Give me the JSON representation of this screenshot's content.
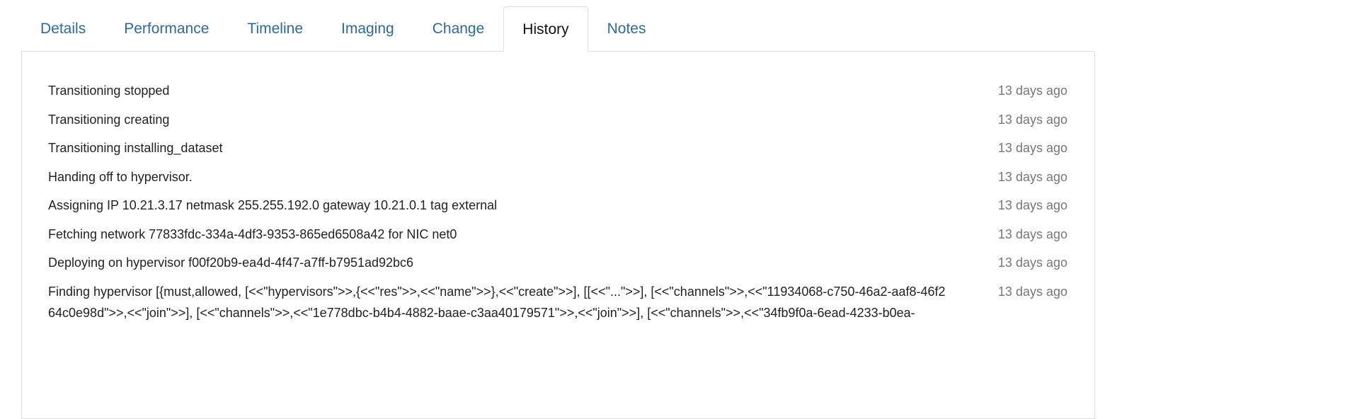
{
  "tabs": [
    {
      "label": "Details",
      "active": false
    },
    {
      "label": "Performance",
      "active": false
    },
    {
      "label": "Timeline",
      "active": false
    },
    {
      "label": "Imaging",
      "active": false
    },
    {
      "label": "Change",
      "active": false
    },
    {
      "label": "History",
      "active": true
    },
    {
      "label": "Notes",
      "active": false
    }
  ],
  "history": [
    {
      "message": "Transitioning stopped",
      "time": "13 days ago"
    },
    {
      "message": "Transitioning creating",
      "time": "13 days ago"
    },
    {
      "message": "Transitioning installing_dataset",
      "time": "13 days ago"
    },
    {
      "message": "Handing off to hypervisor.",
      "time": "13 days ago"
    },
    {
      "message": "Assigning IP 10.21.3.17 netmask 255.255.192.0 gateway 10.21.0.1 tag external",
      "time": "13 days ago"
    },
    {
      "message": "Fetching network 77833fdc-334a-4df3-9353-865ed6508a42 for NIC net0",
      "time": "13 days ago"
    },
    {
      "message": "Deploying on hypervisor f00f20b9-ea4d-4f47-a7ff-b7951ad92bc6",
      "time": "13 days ago"
    },
    {
      "message": "Finding hypervisor [{must,allowed, [<<\"hypervisors\">>,{<<\"res\">>,<<\"name\">>},<<\"create\">>], [[<<\"...\">>], [<<\"channels\">>,<<\"11934068-c750-46a2-aaf8-46f264c0e98d\">>,<<\"join\">>], [<<\"channels\">>,<<\"1e778dbc-b4b4-4882-baae-c3aa40179571\">>,<<\"join\">>], [<<\"channels\">>,<<\"34fb9f0a-6ead-4233-b0ea-",
      "time": "13 days ago"
    }
  ]
}
